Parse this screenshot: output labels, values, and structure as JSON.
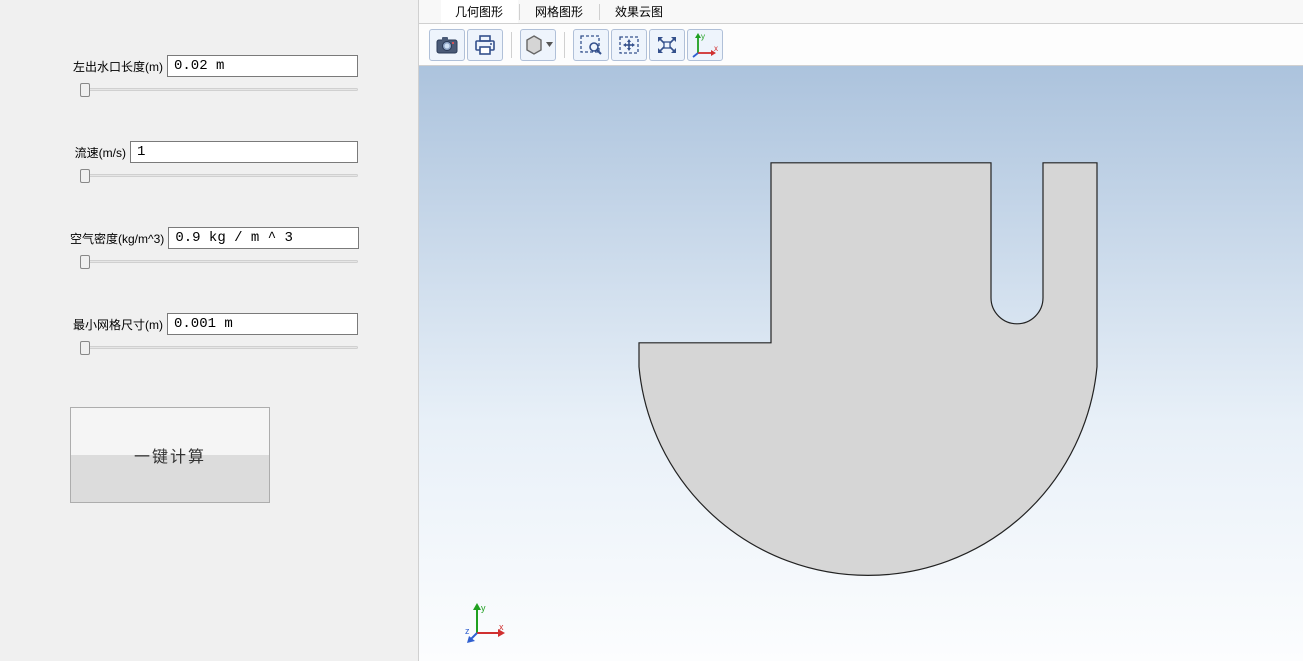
{
  "params": {
    "outlet_length": {
      "label": "左出水口长度(m)",
      "value": "0.02 m"
    },
    "flow_velocity": {
      "label": "流速(m/s)",
      "value": "1"
    },
    "air_density": {
      "label": "空气密度(kg/m^3)",
      "value": "0.9 kg / m ^ 3"
    },
    "min_mesh_size": {
      "label": "最小网格尺寸(m)",
      "value": "0.001 m"
    }
  },
  "actions": {
    "calculate": "一键计算"
  },
  "tabs": {
    "geometry": "几何图形",
    "mesh": "网格图形",
    "contour": "效果云图"
  },
  "toolbar_icons": {
    "screenshot": "screenshot",
    "print": "print",
    "settings": "settings",
    "zoom_box": "zoom-box",
    "pan": "pan",
    "fit": "zoom-fit",
    "axes": "axes"
  },
  "axis_labels": {
    "x": "x",
    "y": "y",
    "z": "z"
  }
}
